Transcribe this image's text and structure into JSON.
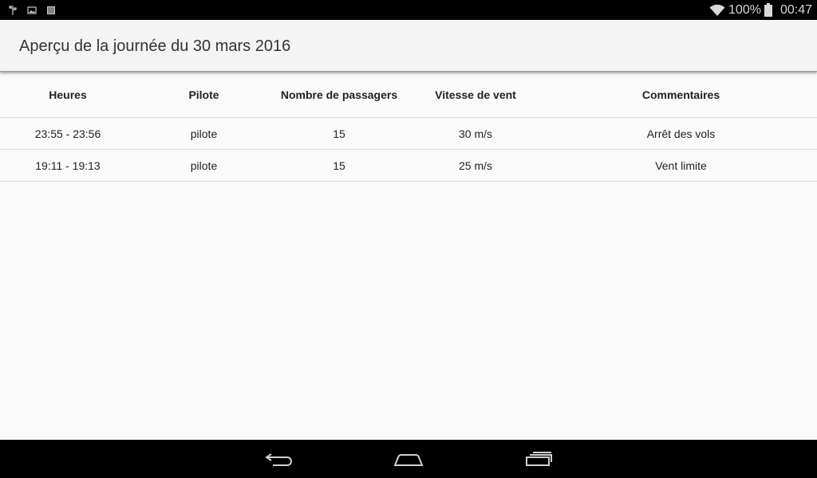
{
  "status_bar": {
    "battery_percent": "100%",
    "time": "00:47",
    "icons": [
      "usb-icon",
      "image-icon",
      "barcode-icon",
      "wifi-icon",
      "battery-icon"
    ]
  },
  "app_bar": {
    "title": "Aperçu de la journée du 30 mars 2016"
  },
  "table": {
    "columns": [
      "Heures",
      "Pilote",
      "Nombre de passagers",
      "Vitesse de vent",
      "Commentaires"
    ],
    "rows": [
      [
        "23:55 - 23:56",
        "pilote",
        "15",
        "30 m/s",
        "Arrêt des vols"
      ],
      [
        "19:11 - 19:13",
        "pilote",
        "15",
        "25 m/s",
        "Vent limite"
      ]
    ]
  },
  "nav_bar": {
    "icons": [
      "back-icon",
      "home-icon",
      "recent-apps-icon"
    ]
  }
}
